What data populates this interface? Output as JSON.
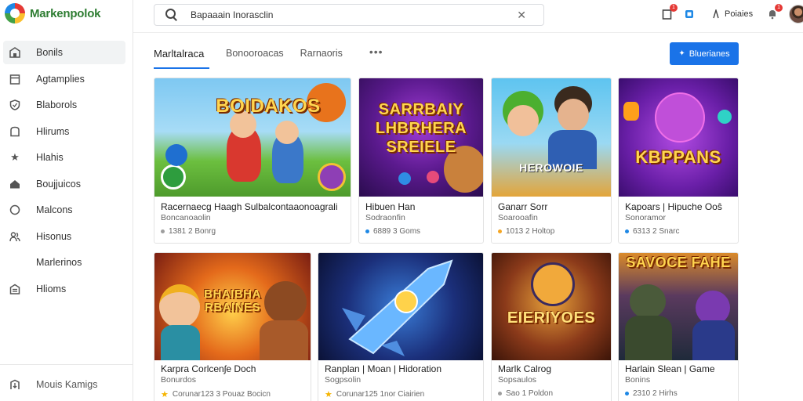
{
  "app": {
    "logo_text": "Markenpolok"
  },
  "sidebar": {
    "items": [
      {
        "label": "Bonils",
        "icon": "store-icon"
      },
      {
        "label": "Agtamplies",
        "icon": "calendar-icon"
      },
      {
        "label": "Blaborols",
        "icon": "shield-icon"
      },
      {
        "label": "Hlirums",
        "icon": "chat-icon"
      },
      {
        "label": "Hlahis",
        "icon": "star-icon"
      },
      {
        "label": "Boujjuicos",
        "icon": "home-icon"
      },
      {
        "label": "Malcons",
        "icon": "circle-icon"
      },
      {
        "label": "Hisonus",
        "icon": "people-icon"
      },
      {
        "label": "Marlerinos",
        "icon": ""
      },
      {
        "label": "Hlioms",
        "icon": "building-icon"
      }
    ],
    "bottom_item": {
      "label": "Mouis Kamigs",
      "icon": "exit-icon"
    }
  },
  "header": {
    "search_value": "Bapaaain Inorasclin",
    "notif_badge": "1",
    "msg_badge": "1",
    "user_label": "Poiaies",
    "alert_badge": "1"
  },
  "tabs": [
    {
      "label": "Marltalraca"
    },
    {
      "label": "Bonooroacas"
    },
    {
      "label": "Rarnaoris"
    }
  ],
  "tabs_more": "•••",
  "primary_button": {
    "label": "Bluerianes"
  },
  "cards": [
    {
      "thumb_title": "BOIDAKOS",
      "title": "Racernaecg Haagh Sulbalcontaaonoagrali",
      "subtitle": "Boncanoaolin",
      "meta": "1381 2 Bonrg"
    },
    {
      "thumb_title": "SARRBAIY LHBRHERA SREIELE",
      "title": "Hibuen Han",
      "subtitle": "Sodraonfin",
      "meta": "6889 3 Goms"
    },
    {
      "thumb_title": "HEROWOIE",
      "title": "Ganarr Sorr",
      "subtitle": "Soarooafin",
      "meta": "1013 2 Holtop"
    },
    {
      "thumb_title": "KBPPANS",
      "title": "Kapoars | Hipuche Ooŝ",
      "subtitle": "Sonoramor",
      "meta": "6313 2 Snarc"
    },
    {
      "thumb_title": "BHAIBHA RBAINES",
      "title": "Karpra Corlcenʃe Doch",
      "subtitle": "Bonurdos",
      "meta": "Corunar123 3 Pouaz Bocicn"
    },
    {
      "thumb_title": "",
      "title": "Ranplan | Moan | Hidoration",
      "subtitle": "Sogpsolin",
      "meta": "Corunar125 1nor Ciairien"
    },
    {
      "thumb_title": "EIERIYOES",
      "title": "Marlk Calrog",
      "subtitle": "Sopsaulos",
      "meta": "Sao 1 Poldon"
    },
    {
      "thumb_title": "SAVOCE FAHE",
      "title": "Harlain Slean | Game",
      "subtitle": "Bonins",
      "meta": "2310 2 Hirhs"
    }
  ]
}
